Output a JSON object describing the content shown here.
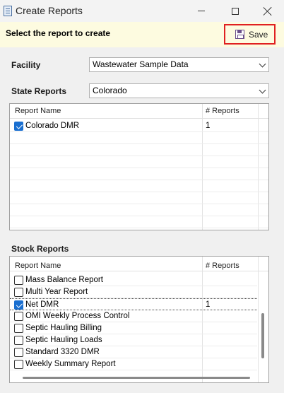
{
  "window": {
    "title": "Create Reports"
  },
  "header": {
    "prompt": "Select the report to create",
    "save_label": "Save"
  },
  "form": {
    "facility_label": "Facility",
    "facility_value": "Wastewater Sample Data",
    "state_label": "State Reports",
    "state_value": "Colorado"
  },
  "state_grid": {
    "columns": [
      "Report Name",
      "# Reports"
    ],
    "rows": [
      {
        "name": "Colorado DMR",
        "count": "1",
        "checked": true
      }
    ]
  },
  "stock_section": {
    "label": "Stock Reports"
  },
  "stock_grid": {
    "columns": [
      "Report Name",
      "# Reports"
    ],
    "rows": [
      {
        "name": "Mass Balance Report",
        "count": "",
        "checked": false
      },
      {
        "name": "Multi Year Report",
        "count": "",
        "checked": false
      },
      {
        "name": "Net DMR",
        "count": "1",
        "checked": true
      },
      {
        "name": "OMI Weekly Process Control",
        "count": "",
        "checked": false
      },
      {
        "name": "Septic Hauling Billing",
        "count": "",
        "checked": false
      },
      {
        "name": "Septic Hauling Loads",
        "count": "",
        "checked": false
      },
      {
        "name": "Standard 3320 DMR",
        "count": "",
        "checked": false
      },
      {
        "name": "Weekly Summary Report",
        "count": "",
        "checked": false
      }
    ]
  },
  "colors": {
    "accent": "#1a6fd0",
    "highlight_border": "#e02020",
    "header_bg": "#fdfbe0"
  }
}
